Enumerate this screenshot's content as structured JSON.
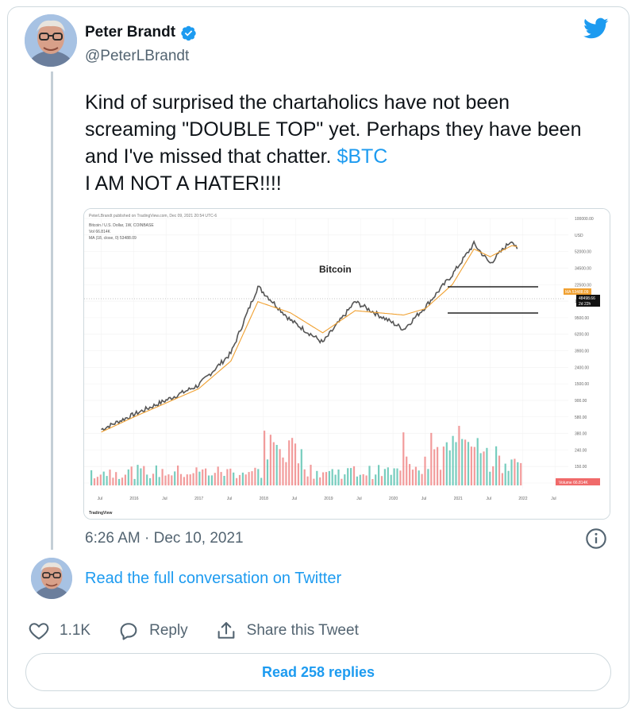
{
  "author": {
    "display_name": "Peter Brandt",
    "handle": "@PeterLBrandt"
  },
  "tweet": {
    "text_before": "Kind of surprised the chartaholics have not been screaming \"DOUBLE TOP\" yet. Perhaps they have been and I've missed that chatter. ",
    "cashtag": "$BTC",
    "text_after": "I AM NOT A HATER!!!!",
    "timestamp": "6:26 AM · Dec 10, 2021"
  },
  "conversation_link": "Read the full conversation on Twitter",
  "actions": {
    "likes": "1.1K",
    "reply": "Reply",
    "share": "Share this Tweet"
  },
  "read_replies": "Read 258 replies",
  "icons": [
    "twitter-bird-icon",
    "verified-badge-icon",
    "info-icon",
    "heart-icon",
    "reply-icon",
    "share-icon"
  ],
  "colors": {
    "accent": "#1d9bf0",
    "muted": "#536471",
    "candles": "#555555",
    "ma_line": "#f0a030",
    "volume_up": "#5fc4b3",
    "volume_down": "#f08b8b"
  },
  "chart_data": {
    "type": "line",
    "title": "Bitcoin",
    "header_line": "PeterLBrandt published on TradingView.com, Dec 09, 2021 20:54 UTC-6",
    "legend": [
      "Bitcoin / U.S. Dollar, 1W, COINBASE",
      "Vol 66.814K",
      "MA (18, close, 0) 53488.09"
    ],
    "y_scale": "log",
    "y_ticks": [
      "100000.00",
      "USD",
      "52000.00",
      "34500.00",
      "22500.00",
      "14500.00",
      "9500.00",
      "6200.00",
      "3900.00",
      "2400.00",
      "1500.00",
      "900.00",
      "580.00",
      "380.00",
      "240.00",
      "150.00",
      "95.00"
    ],
    "x_ticks": [
      "Jul",
      "2016",
      "Jul",
      "2017",
      "Jul",
      "2018",
      "Jul",
      "2019",
      "Jul",
      "2020",
      "Jul",
      "2021",
      "Jul",
      "2022",
      "Jul"
    ],
    "x": [
      "2015-07",
      "2016-01",
      "2016-07",
      "2017-01",
      "2017-07",
      "2017-12",
      "2018-06",
      "2018-12",
      "2019-06",
      "2020-03",
      "2020-07",
      "2020-12",
      "2021-04",
      "2021-07",
      "2021-11",
      "2021-12"
    ],
    "series": [
      {
        "name": "",
        "values": [
          280,
          430,
          650,
          1000,
          2500,
          17000,
          6500,
          3400,
          11000,
          5000,
          9500,
          24000,
          58000,
          33000,
          65000,
          48000
        ]
      },
      {
        "name": "MA (18, close, 0)",
        "values": [
          260,
          400,
          600,
          900,
          2000,
          11000,
          8000,
          4500,
          8500,
          7500,
          9000,
          18000,
          50000,
          40000,
          55000,
          53488.09
        ]
      }
    ],
    "price_labels": [
      "MA 53488.09",
      "48498.66",
      "2d 22h"
    ],
    "volume_label": "Volume 66.814K",
    "annotation": "double-top channel lines",
    "footer": "TradingView"
  }
}
